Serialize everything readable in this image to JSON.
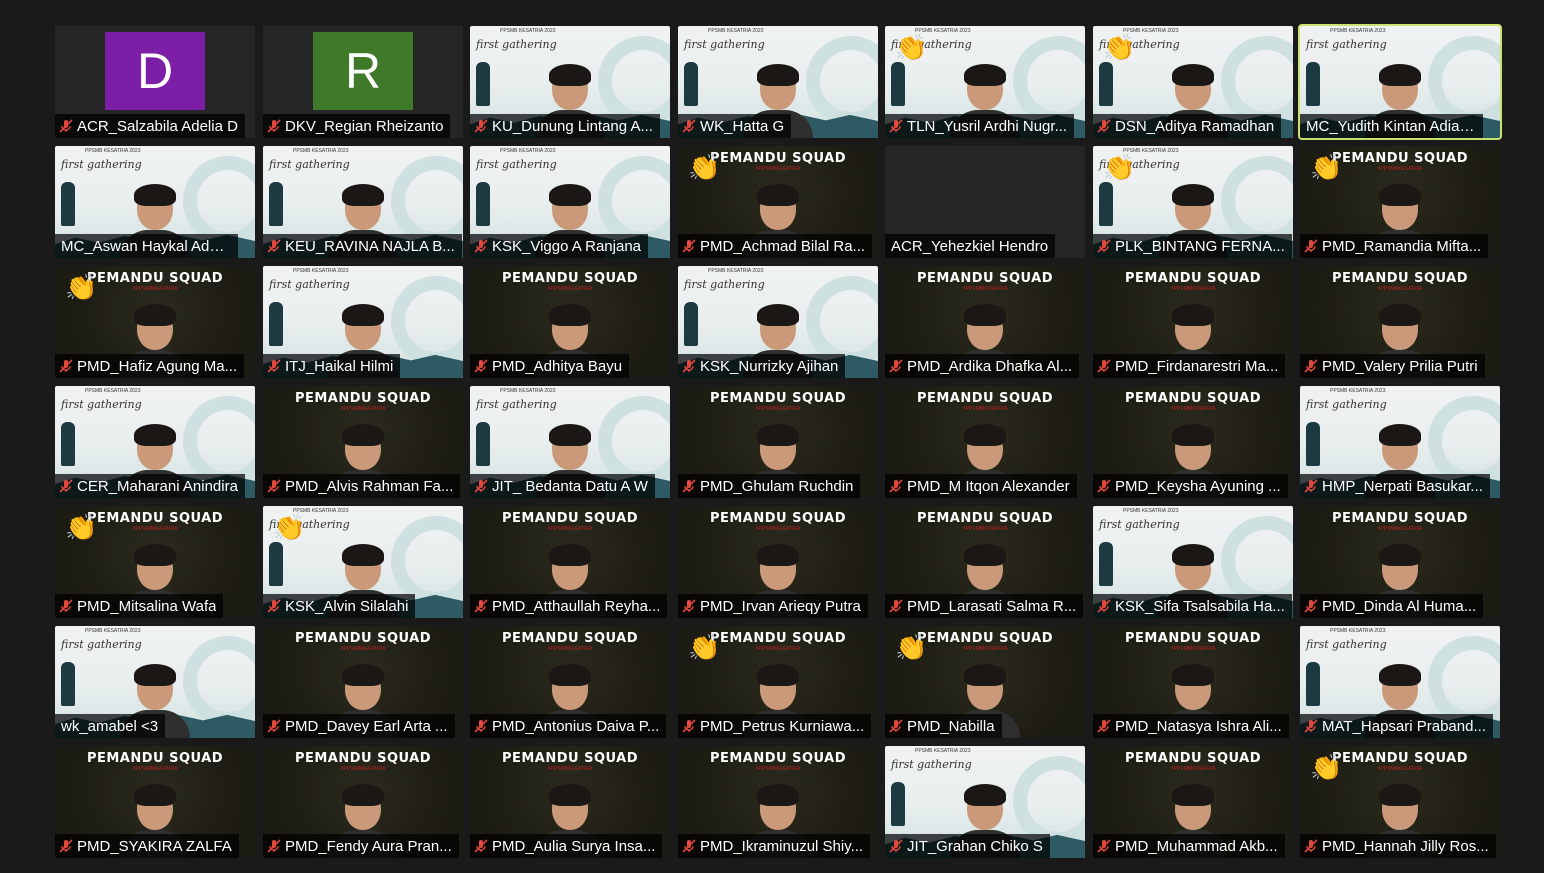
{
  "meeting": {
    "layout": "gallery",
    "background_title": "first gathering",
    "background_subtitle": "PPSMB KESATRIA 2023",
    "squad_title": "PEMANDU SQUAD",
    "squad_tagline": "#PPSMBKESATRIA"
  },
  "participants": [
    {
      "name": "ACR_Salzabila Adelia D",
      "video": "letter",
      "letter": "D",
      "avatar_color": "#7d1fa6",
      "muted": true
    },
    {
      "name": "DKV_Regian Rheizanto",
      "video": "letter",
      "letter": "R",
      "avatar_color": "#3e7a2a",
      "muted": true
    },
    {
      "name": "KU_Dunung Lintang A...",
      "video": "gathering",
      "muted": true
    },
    {
      "name": "WK_Hatta G",
      "video": "gathering",
      "muted": true
    },
    {
      "name": "TLN_Yusril Ardhi Nugr...",
      "video": "gathering",
      "muted": true,
      "reaction": "👏"
    },
    {
      "name": "DSN_Aditya Ramadhan",
      "video": "gathering",
      "muted": true,
      "reaction": "👏"
    },
    {
      "name": "MC_Yudith Kintan Adiaput...",
      "video": "gathering",
      "muted": false,
      "active_speaker": true
    },
    {
      "name": "MC_Aswan Haykal Adam ...",
      "video": "gathering",
      "muted": false
    },
    {
      "name": "KEU_RAVINA NAJLA B...",
      "video": "gathering",
      "muted": true
    },
    {
      "name": "KSK_Viggo A Ranjana",
      "video": "gathering",
      "muted": true
    },
    {
      "name": "PMD_Achmad Bilal Ra...",
      "video": "squad",
      "muted": true,
      "reaction": "👏"
    },
    {
      "name": "ACR_Yehezkiel Hendro",
      "video": "blank",
      "muted": false
    },
    {
      "name": "PLK_BINTANG FERNA...",
      "video": "gathering",
      "muted": true,
      "reaction": "👏"
    },
    {
      "name": "PMD_Ramandia Mifta...",
      "video": "squad",
      "muted": true,
      "reaction": "👏"
    },
    {
      "name": "PMD_Hafiz Agung Ma...",
      "video": "squad",
      "muted": true,
      "reaction": "👏"
    },
    {
      "name": "ITJ_Haikal Hilmi",
      "video": "gathering",
      "muted": true
    },
    {
      "name": "PMD_Adhitya Bayu",
      "video": "squad",
      "muted": true
    },
    {
      "name": "KSK_Nurrizky Ajihan",
      "video": "gathering",
      "muted": true
    },
    {
      "name": "PMD_Ardika Dhafka Al...",
      "video": "squad",
      "muted": true
    },
    {
      "name": "PMD_Firdanarestri Ma...",
      "video": "squad",
      "muted": true
    },
    {
      "name": "PMD_Valery Prilia Putri",
      "video": "squad",
      "muted": true
    },
    {
      "name": "CER_Maharani Anindira",
      "video": "gathering",
      "muted": true
    },
    {
      "name": "PMD_Alvis Rahman Fa...",
      "video": "squad",
      "muted": true
    },
    {
      "name": "JIT_ Bedanta Datu A W",
      "video": "gathering",
      "muted": true
    },
    {
      "name": "PMD_Ghulam Ruchdin",
      "video": "squad",
      "muted": true
    },
    {
      "name": "PMD_M Itqon Alexander",
      "video": "squad",
      "muted": true
    },
    {
      "name": "PMD_Keysha Ayuning ...",
      "video": "squad",
      "muted": true
    },
    {
      "name": "HMP_Nerpati Basukar...",
      "video": "gathering",
      "muted": true
    },
    {
      "name": "PMD_Mitsalina Wafa",
      "video": "squad",
      "muted": true,
      "reaction": "👏"
    },
    {
      "name": "KSK_Alvin Silalahi",
      "video": "gathering",
      "muted": true,
      "reaction": "👏"
    },
    {
      "name": "PMD_Atthaullah Reyha...",
      "video": "squad",
      "muted": true
    },
    {
      "name": "PMD_Irvan Arieqy Putra",
      "video": "squad",
      "muted": true
    },
    {
      "name": "PMD_Larasati Salma R...",
      "video": "squad",
      "muted": true
    },
    {
      "name": "KSK_Sifa Tsalsabila Ha...",
      "video": "gathering",
      "muted": true
    },
    {
      "name": "PMD_Dinda Al Huma...",
      "video": "squad",
      "muted": true
    },
    {
      "name": "wk_amabel <3",
      "video": "gathering",
      "muted": false
    },
    {
      "name": "PMD_Davey Earl Arta ...",
      "video": "squad",
      "muted": true
    },
    {
      "name": "PMD_Antonius Daiva P...",
      "video": "squad",
      "muted": true
    },
    {
      "name": "PMD_Petrus Kurniawa...",
      "video": "squad",
      "muted": true,
      "reaction": "👏"
    },
    {
      "name": "PMD_Nabilla",
      "video": "squad",
      "muted": true,
      "reaction": "👏"
    },
    {
      "name": "PMD_Natasya Ishra Ali...",
      "video": "squad",
      "muted": true
    },
    {
      "name": "MAT_Hapsari Praband...",
      "video": "gathering",
      "muted": true
    },
    {
      "name": "PMD_SYAKIRA ZALFA",
      "video": "squad",
      "muted": true
    },
    {
      "name": "PMD_Fendy Aura Pran...",
      "video": "squad",
      "muted": true
    },
    {
      "name": "PMD_Aulia Surya Insa...",
      "video": "squad",
      "muted": true
    },
    {
      "name": "PMD_Ikraminuzul Shiy...",
      "video": "squad",
      "muted": true
    },
    {
      "name": "JIT_Grahan Chiko S",
      "video": "gathering",
      "muted": true
    },
    {
      "name": "PMD_Muhammad Akb...",
      "video": "squad",
      "muted": true
    },
    {
      "name": "PMD_Hannah Jilly Ros...",
      "video": "squad",
      "muted": true,
      "reaction": "👏"
    }
  ]
}
